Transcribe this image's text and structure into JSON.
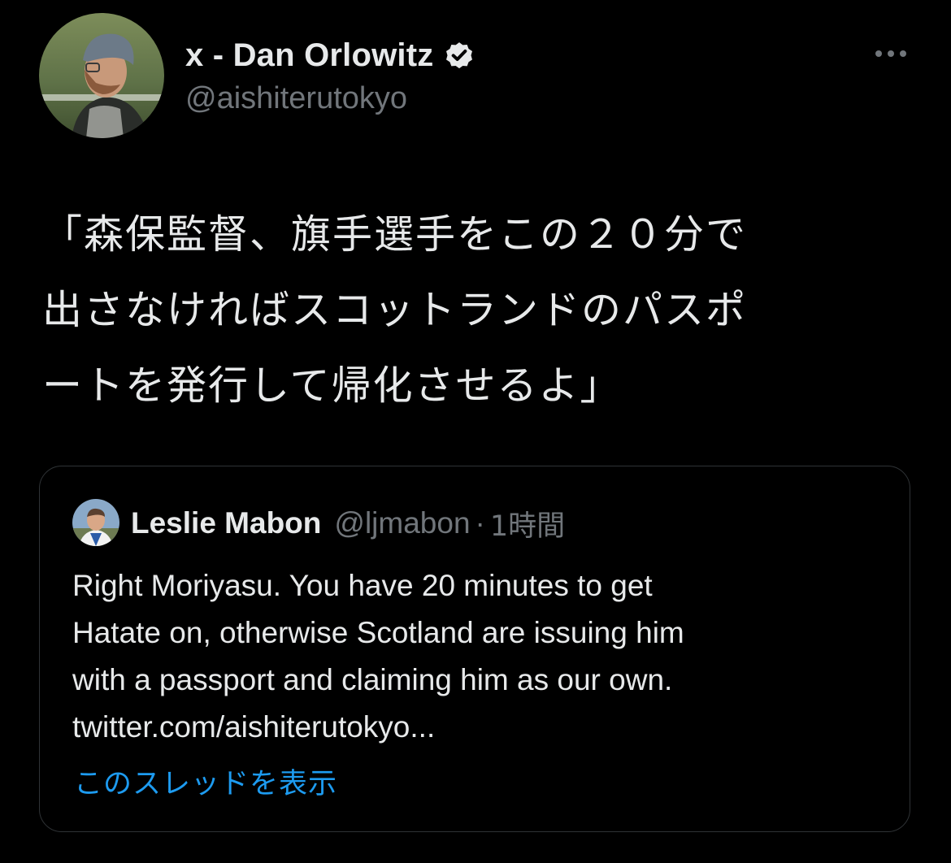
{
  "tweet": {
    "display_name": "x - Dan Orlowitz",
    "handle": "@aishiterutokyo",
    "verified": true,
    "text_lines": [
      "「森保監督、旗手選手をこの２０分で",
      "出さなければスコットランドのパスポ",
      "ートを発行して帰化させるよ」"
    ]
  },
  "quote": {
    "display_name": "Leslie Mabon",
    "handle": "@ljmabon",
    "separator": "·",
    "time": "1時間",
    "text_lines": [
      "Right Moriyasu. You have 20 minutes to get",
      "Hatate on, otherwise Scotland are issuing him",
      "with a passport and claiming him as our own.",
      "twitter.com/aishiterutokyo..."
    ],
    "show_thread_label": "このスレッドを表示"
  },
  "icons": {
    "avatar": "profile-photo",
    "verified": "verified-badge-icon",
    "more": "more-options-icon"
  },
  "colors": {
    "background": "#000000",
    "primary_text": "#e7e9ea",
    "secondary_text": "#71767b",
    "link": "#1d9bf0",
    "border": "#2f3336"
  }
}
